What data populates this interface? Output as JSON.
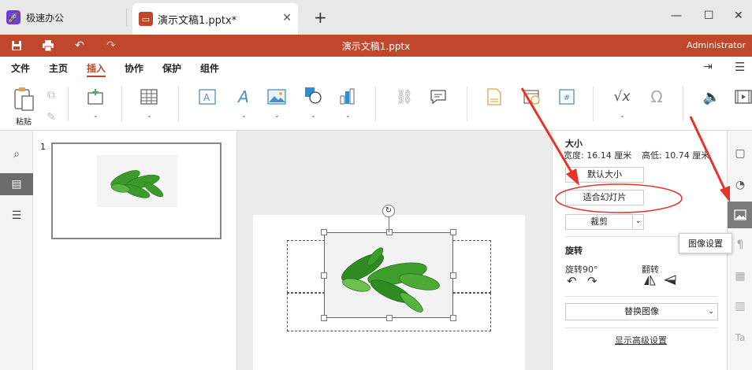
{
  "tabs": [
    {
      "label": "极速办公",
      "icon": "rocket-icon",
      "color": "#6a3fd8"
    },
    {
      "label": "演示文稿1.pptx*",
      "icon": "presentation-icon",
      "color": "#c0472c"
    }
  ],
  "window": {
    "new_tab": "+",
    "min": "—",
    "max": "☐",
    "close": "✕"
  },
  "titlebar": {
    "title": "演示文稿1.pptx",
    "user": "Administrator",
    "color": "#c0472c"
  },
  "menu": {
    "items": [
      "文件",
      "主页",
      "插入",
      "协作",
      "保护",
      "组件"
    ],
    "active": "插入"
  },
  "ribbon": {
    "paste_label": "粘贴"
  },
  "slides": {
    "thumb_number": "1"
  },
  "props": {
    "size_title": "大小",
    "width_label": "宽度: 16.14 厘米",
    "height_label": "高低: 10.74 厘米",
    "default_size": "默认大小",
    "fit_slide": "适合幻灯片",
    "crop": "裁剪",
    "rotate_title": "旋转",
    "rotate90": "旋转90°",
    "flip": "翻转",
    "replace_image": "替换图像",
    "advanced": "显示高级设置"
  },
  "tooltip": "图像设置",
  "annotations": {
    "arrow_color": "#e8332b"
  }
}
